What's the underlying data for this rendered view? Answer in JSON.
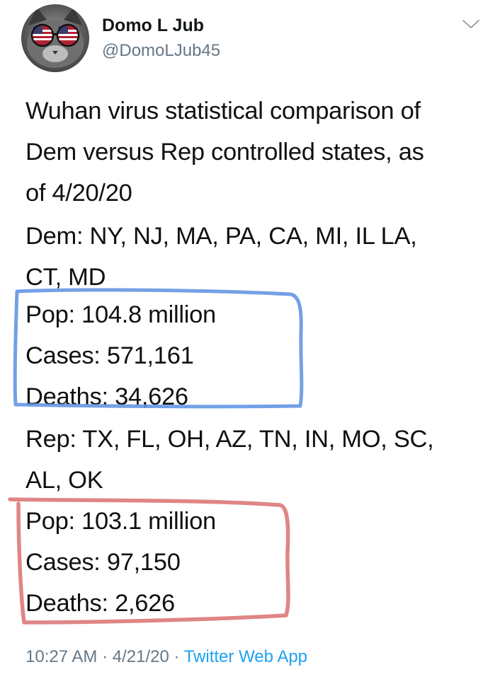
{
  "user": {
    "display_name": "Domo L Jub",
    "handle": "@DomoLJub45"
  },
  "icons": {
    "menu": "chevron-down-icon",
    "avatar": "avatar-cat-sunglasses"
  },
  "tweet": {
    "line_1": "Wuhan virus statistical comparison of",
    "line_2": "Dem versus Rep controlled states, as",
    "line_3": "of 4/20/20",
    "dem_line_1": "Dem:  NY, NJ, MA, PA, CA, MI, IL LA,",
    "dem_line_2": "CT, MD",
    "dem_pop": "Pop:  104.8 million",
    "dem_cases": "Cases:  571,161",
    "dem_deaths": "Deaths: 34,626",
    "rep_line_1": "Rep: TX, FL, OH, AZ, TN, IN, MO, SC,",
    "rep_line_2": "AL, OK",
    "rep_pop": "Pop:  103.1 million",
    "rep_cases": "Cases: 97,150",
    "rep_deaths": "Deaths:  2,626"
  },
  "footer": {
    "time": "10:27 AM",
    "separator_1": " · ",
    "date": "4/21/20",
    "separator_2": " · ",
    "source": "Twitter Web App"
  },
  "colors": {
    "dem_box": "#5b8fe0",
    "rep_box": "#d97070",
    "link": "#1da1f2",
    "meta_text": "#657786"
  }
}
